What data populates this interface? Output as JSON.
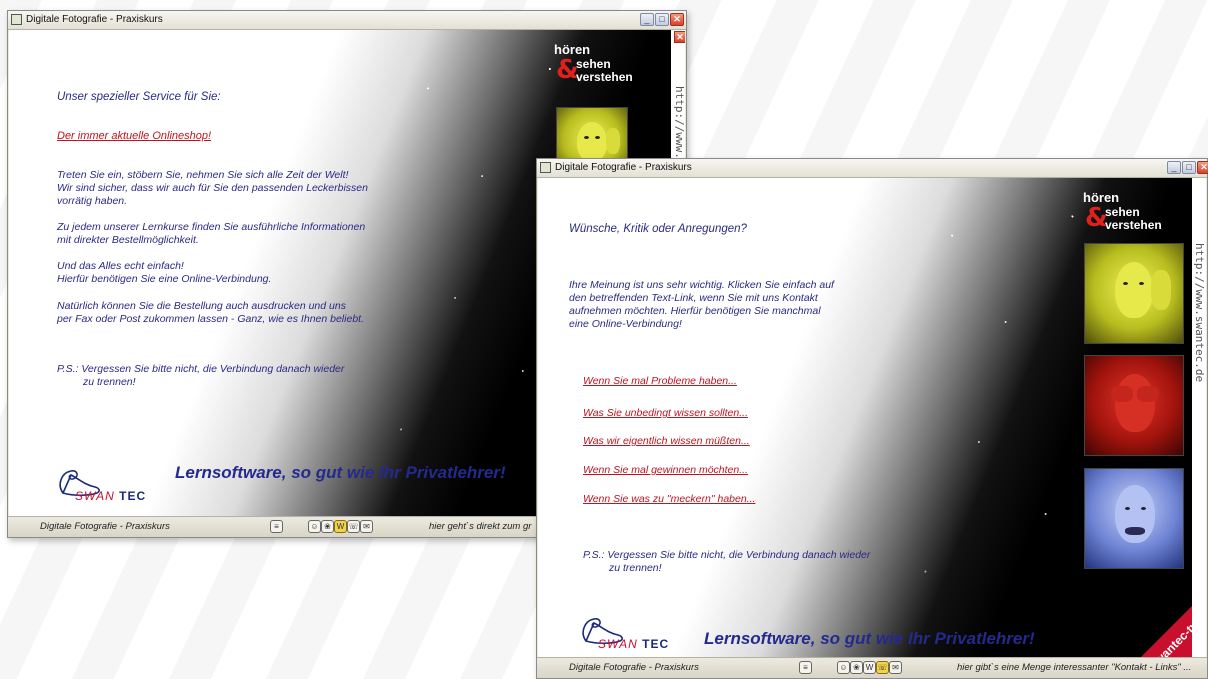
{
  "windows": {
    "back": {
      "title": "Digitale Fotografie - Praxiskurs",
      "content": {
        "heading": "Unser spezieller Service für Sie:",
        "shop_link": "Der immer aktuelle Onlineshop!",
        "para1": [
          "Treten Sie ein, stöbern Sie, nehmen Sie sich alle Zeit der Welt!",
          "Wir sind sicher, dass wir auch für Sie den passenden Leckerbissen",
          "vorrätig haben."
        ],
        "para2": [
          "Zu jedem unserer Lernkurse finden Sie ausführliche Informationen",
          "mit direkter Bestellmöglichkeit."
        ],
        "para3": [
          "Und das Alles echt einfach!",
          "Hierfür benötigen Sie eine Online-Verbindung."
        ],
        "para4": [
          "Natürlich können Sie die Bestellung auch ausdrucken und uns",
          "per Fax oder Post zukommen lassen - Ganz, wie es Ihnen beliebt."
        ],
        "ps": [
          "P.S.:  Vergessen Sie bitte nicht, die Verbindung danach wieder",
          "zu trennen!"
        ],
        "slogan": "Lernsoftware, so gut wie Ihr Privatlehrer!",
        "url_vertical": "http://www.s"
      },
      "status": {
        "title": "Digitale Fotografie - Praxiskurs",
        "hint": "hier geht`s direkt zum gr"
      }
    },
    "front": {
      "title": "Digitale Fotografie - Praxiskurs",
      "content": {
        "heading": "Wünsche, Kritik oder Anregungen?",
        "intro": [
          "Ihre Meinung ist uns sehr wichtig. Klicken Sie einfach auf",
          "den betreffenden Text-Link, wenn Sie mit uns Kontakt",
          "aufnehmen möchten. Hierfür benötigen Sie manchmal",
          "eine Online-Verbindung!"
        ],
        "links": [
          "Wenn Sie mal Probleme haben...",
          "Was Sie unbedingt wissen sollten...",
          "Was wir eigentlich wissen müßten...",
          "Wenn Sie mal gewinnen möchten...",
          "Wenn Sie was zu \"meckern\" haben..."
        ],
        "ps": [
          "P.S.:  Vergessen Sie bitte nicht, die Verbindung danach wieder",
          "zu trennen!"
        ],
        "slogan": "Lernsoftware, so gut wie Ihr Privatlehrer!",
        "url_vertical": "http://www.swantec.de",
        "corner_badge": "swantec-tv"
      },
      "status": {
        "title": "Digitale Fotografie - Praxiskurs",
        "hint": "hier gibt`s eine Menge interessanter \"Kontakt - Links\" ..."
      }
    }
  },
  "brand": {
    "word1": "hören",
    "amp": "&",
    "word2": "sehen",
    "word3": "verstehen"
  },
  "logo": {
    "swan": "SWAN",
    "tec": "TEC"
  },
  "window_buttons": {
    "minimize": "_",
    "maximize": "□",
    "close": "✕"
  },
  "colors": {
    "text": "#2a2a86",
    "link": "#c0141e",
    "slogan": "#232a8e",
    "brand_amp": "#e0201c",
    "badge": "#c8102e"
  }
}
